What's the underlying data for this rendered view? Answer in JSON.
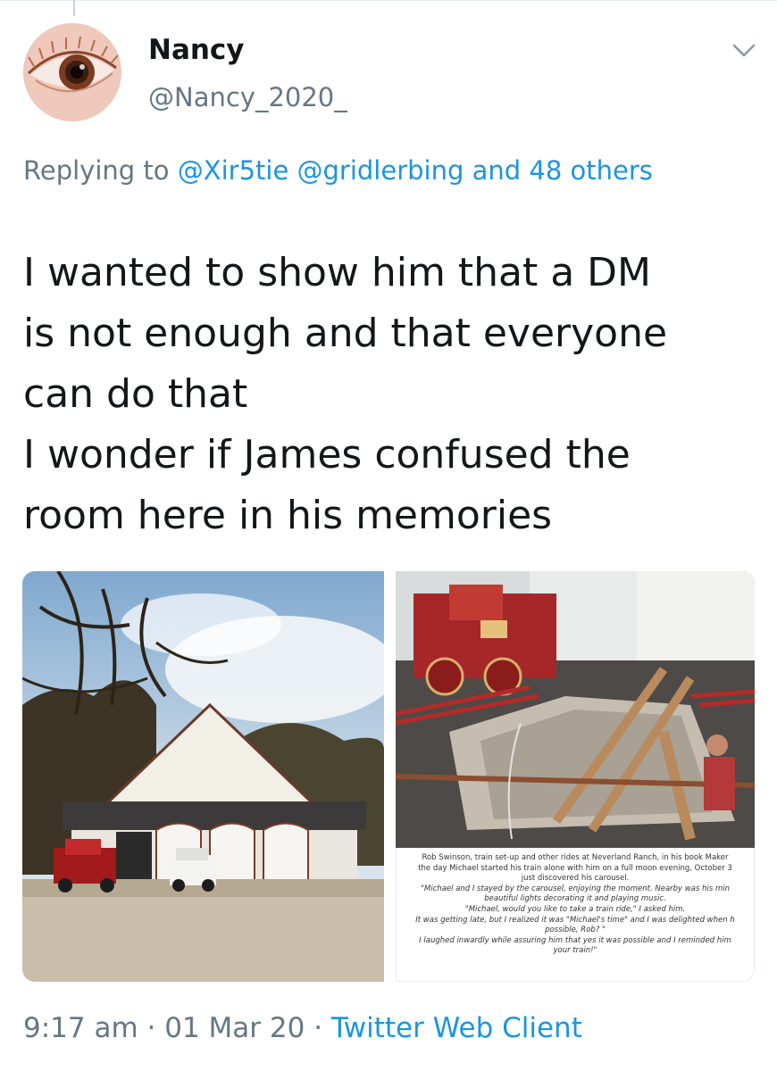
{
  "tweet": {
    "author": {
      "display_name": "Nancy",
      "handle": "@Nancy_2020_"
    },
    "reply": {
      "prefix": "Replying to",
      "mentions": [
        "@Xir5tie",
        "@gridlerbing"
      ],
      "connector": "and",
      "others": "48 others"
    },
    "text": "I wanted to show him that a DM\nis not enough and that everyone\ncan do that\nI wonder if James confused the\nroom here in his memories",
    "media": {
      "left_image": "neverland-train-barn-photo",
      "right_image": "neverland-train-pit-photo",
      "right_caption": [
        "Rob Swinson, train set-up and other rides at Neverland Ranch, in his book Maker",
        "the day Michael started his train alone with him on a full moon evening, October 3",
        "just discovered his carousel.",
        "\"Michael and I stayed by the carousel, enjoying the moment. Nearby was his min",
        "beautiful lights decorating it and playing music.",
        "\"Michael, would you like to take a train ride,\" I asked him.",
        "It was getting late, but I realized it was \"Michael's time\" and I was delighted when h",
        "possible, Rob? \"",
        "I laughed inwardly while assuring him that yes it was possible and I reminded him",
        "your train!\""
      ]
    },
    "footer": {
      "time": "9:17 am",
      "separator": "·",
      "date": "01 Mar 20",
      "client": "Twitter Web Client"
    }
  },
  "colors": {
    "text": "#14171a",
    "secondary": "#657786",
    "link": "#1b95e0"
  },
  "icons": {
    "caret": "chevron-down-icon"
  }
}
